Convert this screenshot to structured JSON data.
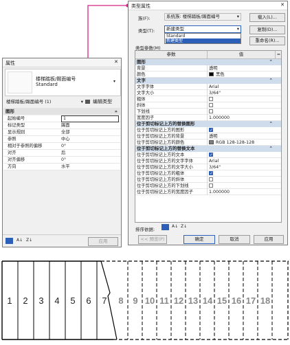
{
  "properties_panel": {
    "title": "属性",
    "family_line1": "楼梯踏板/踢面编号",
    "family_line2": "Standard",
    "selector_text": "楼梯踏板/踢面编号 (1)",
    "edit_type_label": "编辑类型",
    "group_title": "图形",
    "rows": [
      {
        "label": "起始编号",
        "value": "1"
      },
      {
        "label": "标记类型",
        "value": "踢面"
      },
      {
        "label": "显示规则",
        "value": "全部"
      },
      {
        "label": "参照",
        "value": "中心"
      },
      {
        "label": "相对于参照的偏移",
        "value": "0°"
      },
      {
        "label": "对齐",
        "value": "后"
      },
      {
        "label": "对齐偏移",
        "value": "0°"
      },
      {
        "label": "方向",
        "value": "水平"
      }
    ],
    "apply_label": "应用"
  },
  "type_dialog": {
    "title": "类型属性",
    "family_label": "族(F):",
    "family_value": "系统族: 楼梯踏板/踢面编号",
    "load_label": "载入(L)...",
    "type_label": "类型(T):",
    "type_value": "新建类型",
    "duplicate_label": "复制(D)...",
    "rename_label": "重命名(R)...",
    "dropdown_options": [
      "Standard",
      "新建类型"
    ],
    "params_label": "类型参数(M)",
    "col_param": "参数",
    "col_value": "值",
    "sections": [
      {
        "title": "图形",
        "rows": [
          {
            "label": "背景",
            "value": "透明",
            "kind": "text"
          },
          {
            "label": "颜色",
            "value": "黑色",
            "kind": "color",
            "color": "#000000"
          }
        ]
      },
      {
        "title": "文字",
        "rows": [
          {
            "label": "文字字体",
            "value": "Arial",
            "kind": "text"
          },
          {
            "label": "文字大小",
            "value": "3/64\"",
            "kind": "text"
          },
          {
            "label": "粗体",
            "value": "",
            "kind": "check",
            "checked": false
          },
          {
            "label": "斜体",
            "value": "",
            "kind": "check",
            "checked": false
          },
          {
            "label": "下划线",
            "value": "",
            "kind": "check",
            "checked": false
          },
          {
            "label": "宽度因子",
            "value": "1.000000",
            "kind": "text"
          }
        ]
      },
      {
        "title": "位于剪切标记上方的替换图形",
        "rows": [
          {
            "label": "位于剪切标记上方的图形",
            "value": "",
            "kind": "check",
            "checked": true
          },
          {
            "label": "位于剪切标记上方的背景",
            "value": "透明",
            "kind": "text"
          },
          {
            "label": "位于剪切标记上方的颜色",
            "value": "RGB 128-128-128",
            "kind": "color",
            "color": "#808080"
          }
        ]
      },
      {
        "title": "位于剪切标记上方的替换文本",
        "rows": [
          {
            "label": "位于剪切标记上方的文本",
            "value": "",
            "kind": "check",
            "checked": true
          },
          {
            "label": "位于剪切标记上方的文字字体",
            "value": "Arial",
            "kind": "text"
          },
          {
            "label": "位于剪切标记上方的文字大小",
            "value": "3/64\"",
            "kind": "text"
          },
          {
            "label": "位于剪切标记上方的粗体",
            "value": "",
            "kind": "check",
            "checked": true
          },
          {
            "label": "位于剪切标记上方的斜体",
            "value": "",
            "kind": "check",
            "checked": false
          },
          {
            "label": "位于剪切标记上方的下划线",
            "value": "",
            "kind": "check",
            "checked": false
          },
          {
            "label": "位于剪切标记上方的宽度因子",
            "value": "1.000000",
            "kind": "text"
          }
        ]
      }
    ],
    "sort_label": "排序依据:",
    "preview_label": "<< 预览(P)",
    "ok_label": "确定",
    "cancel_label": "取消",
    "apply_label": "应用"
  },
  "stair": {
    "solid_numbers": [
      "1",
      "2",
      "3",
      "4",
      "5",
      "6",
      "7"
    ],
    "dashed_numbers": [
      "8",
      "9",
      "10",
      "11",
      "12",
      "13",
      "14",
      "15",
      "16",
      "17",
      "18"
    ]
  },
  "colors": {
    "callout": "#d6248a",
    "section_bg": "#cfdcec",
    "accent_blue": "#2c5fb8"
  }
}
